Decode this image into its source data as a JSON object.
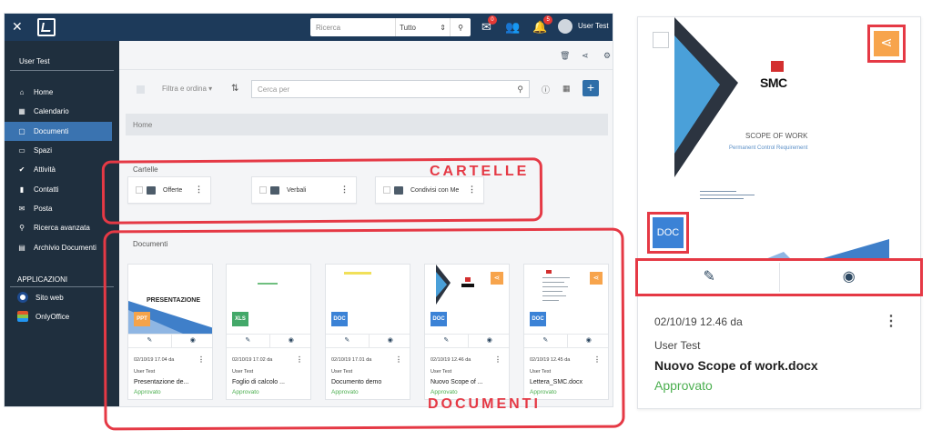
{
  "topbar": {
    "close_icon": "close-icon",
    "search_placeholder": "Ricerca",
    "search_scope": "Tutto",
    "mail_badge": "0",
    "notif_badge": "5",
    "user": "User Test"
  },
  "sidebar": {
    "user": "User Test",
    "items": [
      {
        "label": "Home",
        "icon": "home-icon",
        "glyph": "⌂"
      },
      {
        "label": "Calendario",
        "icon": "calendar-icon",
        "glyph": "▦"
      },
      {
        "label": "Documenti",
        "icon": "document-icon",
        "glyph": "▢"
      },
      {
        "label": "Spazi",
        "icon": "monitor-icon",
        "glyph": "▭"
      },
      {
        "label": "Attività",
        "icon": "check-icon",
        "glyph": "✔"
      },
      {
        "label": "Contatti",
        "icon": "contacts-icon",
        "glyph": "▮"
      },
      {
        "label": "Posta",
        "icon": "mail-icon",
        "glyph": "✉"
      },
      {
        "label": "Ricerca avanzata",
        "icon": "search-icon",
        "glyph": "⚲"
      },
      {
        "label": "Archivio Documenti",
        "icon": "archive-icon",
        "glyph": "▤"
      }
    ],
    "apps_title": "APPLICAZIONI",
    "apps": [
      {
        "label": "Sito web",
        "color": "#1e4b8f"
      },
      {
        "label": "OnlyOffice",
        "color": "#e0552a"
      }
    ]
  },
  "filterbar": {
    "filter_label": "Filtra e ordina",
    "search_placeholder": "Cerca per"
  },
  "breadcrumb": "Home",
  "folders_section": "Cartelle",
  "folders": [
    {
      "name": "Offerte"
    },
    {
      "name": "Verbali"
    },
    {
      "name": "Condivisi con Me"
    }
  ],
  "documents_section": "Documenti",
  "annotations": {
    "cartelle": "CARTELLE",
    "documenti": "DOCUMENTI"
  },
  "documents": [
    {
      "type": "PPT",
      "type_color": "#f5a34a",
      "date": "02/10/19 17.04 da",
      "user": "User Test",
      "name": "Presentazione de...",
      "status": "Approvato",
      "thumb_title": "PRESENTAZIONE"
    },
    {
      "type": "XLS",
      "type_color": "#43a869",
      "date": "02/10/19 17.02 da",
      "user": "User Test",
      "name": "Foglio di calcolo ...",
      "status": "Approvato"
    },
    {
      "type": "DOC",
      "type_color": "#3b82d6",
      "date": "02/10/19 17.01 da",
      "user": "User Test",
      "name": "Documento demo",
      "status": "Approvato"
    },
    {
      "type": "DOC",
      "type_color": "#3b82d6",
      "date": "02/10/19 12.46 da",
      "user": "User Test",
      "name": "Nuovo Scope of ...",
      "status": "Approvato"
    },
    {
      "type": "DOC",
      "type_color": "#3b82d6",
      "date": "02/10/19 12.45 da",
      "user": "User Test",
      "name": "Lettera_SMC.docx",
      "status": "Approvato"
    }
  ],
  "detail": {
    "logo": "SMC",
    "title": "SCOPE OF WORK",
    "subtitle": "Permanent Control Requirement",
    "type": "DOC",
    "date": "02/10/19 12.46 da",
    "user": "User Test",
    "name": "Nuovo Scope of work.docx",
    "status": "Approvato"
  },
  "colors": {
    "topbar": "#1d3a5a",
    "sidebar": "#1f2f3e",
    "active": "#3a73b0",
    "annotation": "#e53945",
    "share": "#f7a44c",
    "approved": "#4caf50"
  }
}
